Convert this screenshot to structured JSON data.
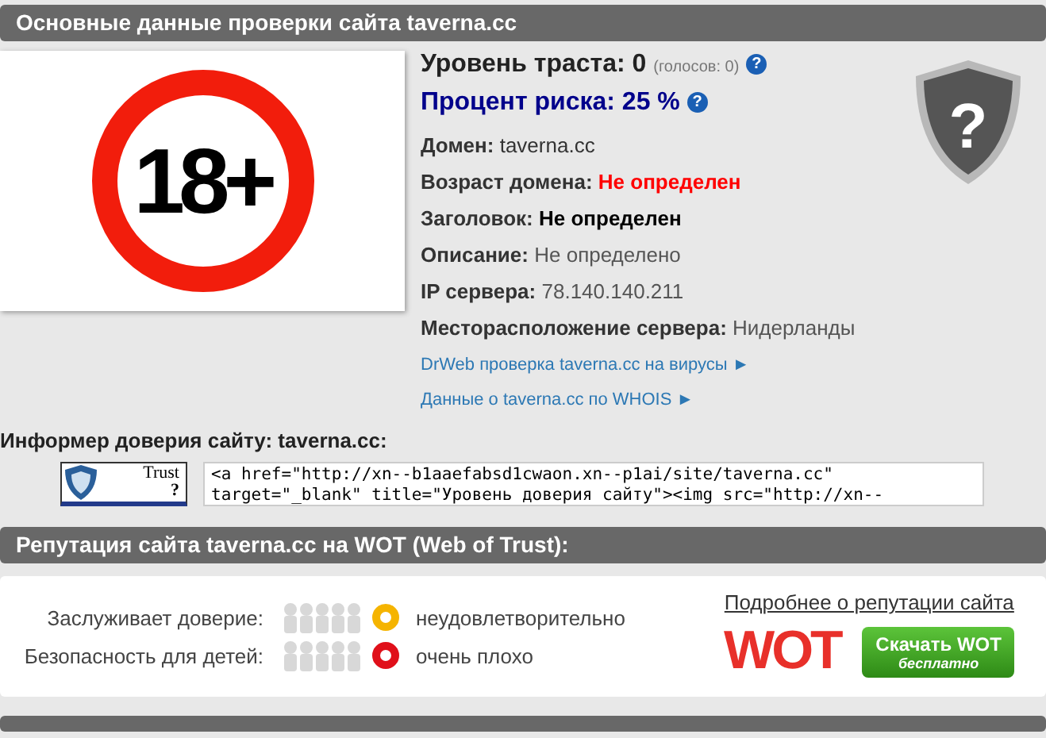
{
  "header": "Основные данные проверки сайта taverna.cc",
  "age_sign": "18+",
  "trust": {
    "label": "Уровень траста:",
    "value": "0",
    "votes": "(голосов: 0)",
    "help": "?"
  },
  "risk": {
    "label": "Процент риска:",
    "value": "25 %",
    "help": "?"
  },
  "fields": [
    {
      "label": "Домен:",
      "value": "taverna.cc",
      "kind": "plain"
    },
    {
      "label": "Возраст домена:",
      "value": "Не определен",
      "kind": "alert"
    },
    {
      "label": "Заголовок:",
      "value": "Не определен",
      "kind": "strong"
    },
    {
      "label": "Описание:",
      "value": "Не определено",
      "kind": "muted"
    },
    {
      "label": "IP сервера:",
      "value": "78.140.140.211",
      "kind": "muted"
    },
    {
      "label": "Месторасположение сервера:",
      "value": "Нидерланды",
      "kind": "muted"
    }
  ],
  "links": [
    "DrWeb проверка taverna.cc на вирусы ►",
    "Данные о taverna.cc по WHOIS ►"
  ],
  "shield_mark": "?",
  "informer": {
    "title": "Информер доверия сайту: taverna.cc:",
    "badge_text": "Trust",
    "badge_mark": "?",
    "code": "<a href=\"http://xn--b1aaefabsd1cwaon.xn--p1ai/site/taverna.cc\" target=\"_blank\" title=\"Уровень доверия сайту\"><img src=\"http://xn--"
  },
  "wot_header": "Репутация сайта taverna.cc на WOT (Web of Trust):",
  "ratings": [
    {
      "label": "Заслуживает доверие:",
      "color": "#f5b400",
      "verdict": "неудовлетворительно"
    },
    {
      "label": "Безопасность для детей:",
      "color": "#e0101a",
      "verdict": "очень плохо"
    }
  ],
  "more_link": "Подробнее о репутации сайта",
  "wot_logo": "WOT",
  "download": {
    "label": "Скачать WOT",
    "sub": "бесплатно"
  }
}
